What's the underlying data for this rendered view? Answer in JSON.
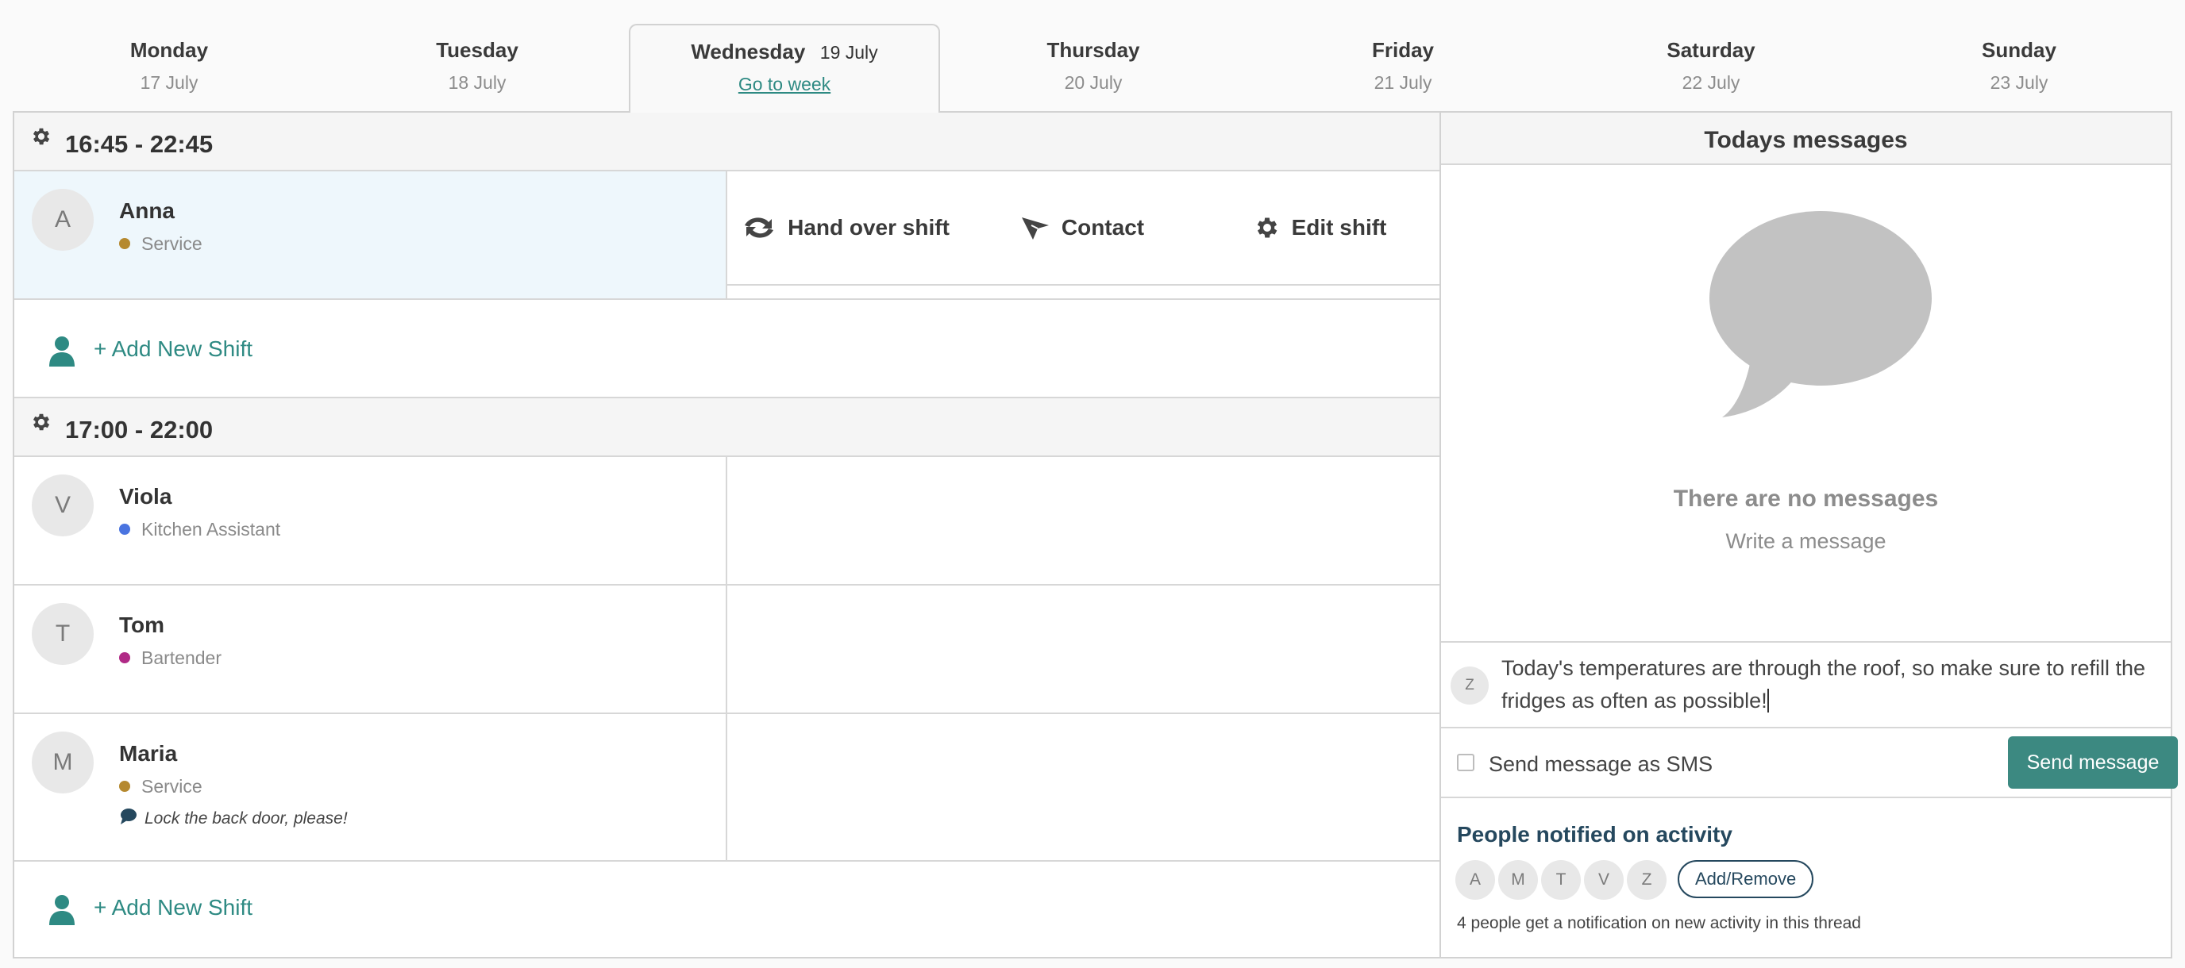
{
  "days": [
    {
      "name": "Monday",
      "date": "17 July"
    },
    {
      "name": "Tuesday",
      "date": "18 July"
    },
    {
      "name": "Wednesday",
      "date": "19 July",
      "link": "Go to week"
    },
    {
      "name": "Thursday",
      "date": "20 July"
    },
    {
      "name": "Friday",
      "date": "21 July"
    },
    {
      "name": "Saturday",
      "date": "22 July"
    },
    {
      "name": "Sunday",
      "date": "23 July"
    }
  ],
  "shifts": [
    {
      "time": "16:45 - 22:45",
      "people": [
        {
          "initial": "A",
          "name": "Anna",
          "role": "Service",
          "role_color": "#b5892f"
        }
      ],
      "actions": {
        "hand_over": "Hand over shift",
        "contact": "Contact",
        "edit": "Edit shift"
      },
      "add_label": "+ Add New Shift"
    },
    {
      "time": "17:00 - 22:00",
      "people": [
        {
          "initial": "V",
          "name": "Viola",
          "role": "Kitchen Assistant",
          "role_color": "#4a74e0"
        },
        {
          "initial": "T",
          "name": "Tom",
          "role": "Bartender",
          "role_color": "#b02a86"
        },
        {
          "initial": "M",
          "name": "Maria",
          "role": "Service",
          "role_color": "#b5892f",
          "note": "Lock the back door, please!"
        }
      ],
      "add_label": "+ Add New Shift"
    }
  ],
  "messages": {
    "title": "Todays messages",
    "empty_title": "There are no messages",
    "empty_sub": "Write a message",
    "composer_initial": "Z",
    "composer_text": "Today's temperatures are through the roof, so make sure to refill the fridges as often as possible!",
    "sms_label": "Send message as SMS",
    "send_label": "Send message"
  },
  "notifications": {
    "title": "People notified on activity",
    "people": [
      "A",
      "M",
      "T",
      "V",
      "Z"
    ],
    "add_remove": "Add/Remove",
    "summary": "4 people get a notification on new activity in this thread"
  },
  "colors": {
    "accent": "#2e8a83",
    "button": "#3c8981",
    "selected_row": "#eef7fc",
    "dark_blue": "#25485e"
  }
}
